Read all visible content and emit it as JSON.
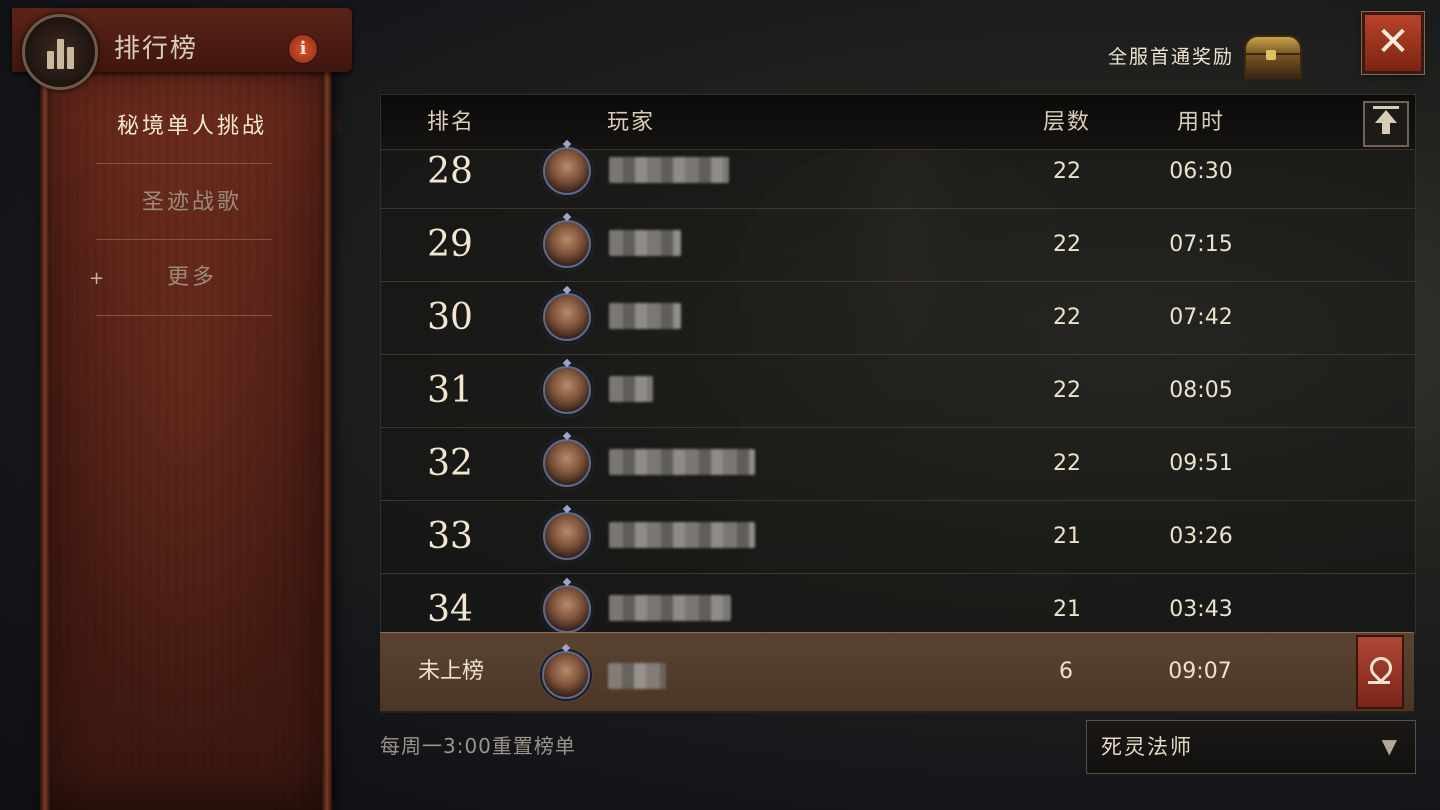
{
  "header": {
    "title": "排行榜",
    "info_icon": "info-icon",
    "reward_label": "全服首通奖励",
    "close_icon": "close-icon"
  },
  "sidebar": {
    "items": [
      {
        "label": "秘境单人挑战",
        "active": true
      },
      {
        "label": "圣迹战歌",
        "active": false
      },
      {
        "label": "更多",
        "active": false,
        "icon": "plus-icon"
      }
    ]
  },
  "table": {
    "columns": [
      "排名",
      "玩家",
      "层数",
      "用时"
    ],
    "rows": [
      {
        "rank": "28",
        "floor": "22",
        "time": "06:30"
      },
      {
        "rank": "29",
        "floor": "22",
        "time": "07:15"
      },
      {
        "rank": "30",
        "floor": "22",
        "time": "07:42"
      },
      {
        "rank": "31",
        "floor": "22",
        "time": "08:05"
      },
      {
        "rank": "32",
        "floor": "22",
        "time": "09:51"
      },
      {
        "rank": "33",
        "floor": "21",
        "time": "03:26"
      },
      {
        "rank": "34",
        "floor": "21",
        "time": "03:43"
      }
    ],
    "self": {
      "rank": "未上榜",
      "floor": "6",
      "time": "09:07"
    }
  },
  "footer": {
    "reset_note": "每周一3:00重置榜单",
    "class_selected": "死灵法师"
  },
  "colors": {
    "accent": "#b8442a",
    "banner": "#5a2318",
    "text": "#ece2cc"
  }
}
